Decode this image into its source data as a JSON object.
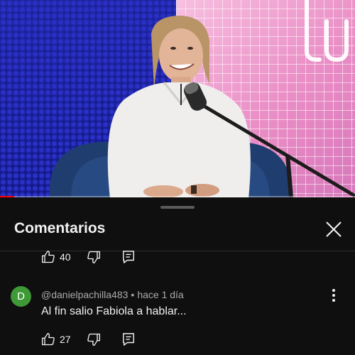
{
  "video": {
    "progress_fraction": 0.04,
    "colors": {
      "progress": "#ff0000",
      "wall_left": "#1d22a8",
      "wall_right": "#f2a6d2"
    }
  },
  "comments_panel": {
    "title": "Comentarios",
    "close_icon": "close-icon",
    "previous_comment": {
      "likes": "40"
    },
    "comment": {
      "avatar_letter": "D",
      "avatar_color": "#3e9a36",
      "author": "@danielpachilla483",
      "separator": "•",
      "time": "hace 1 día",
      "text": "Al fin salio Fabiola a hablar...",
      "likes": "27"
    }
  }
}
